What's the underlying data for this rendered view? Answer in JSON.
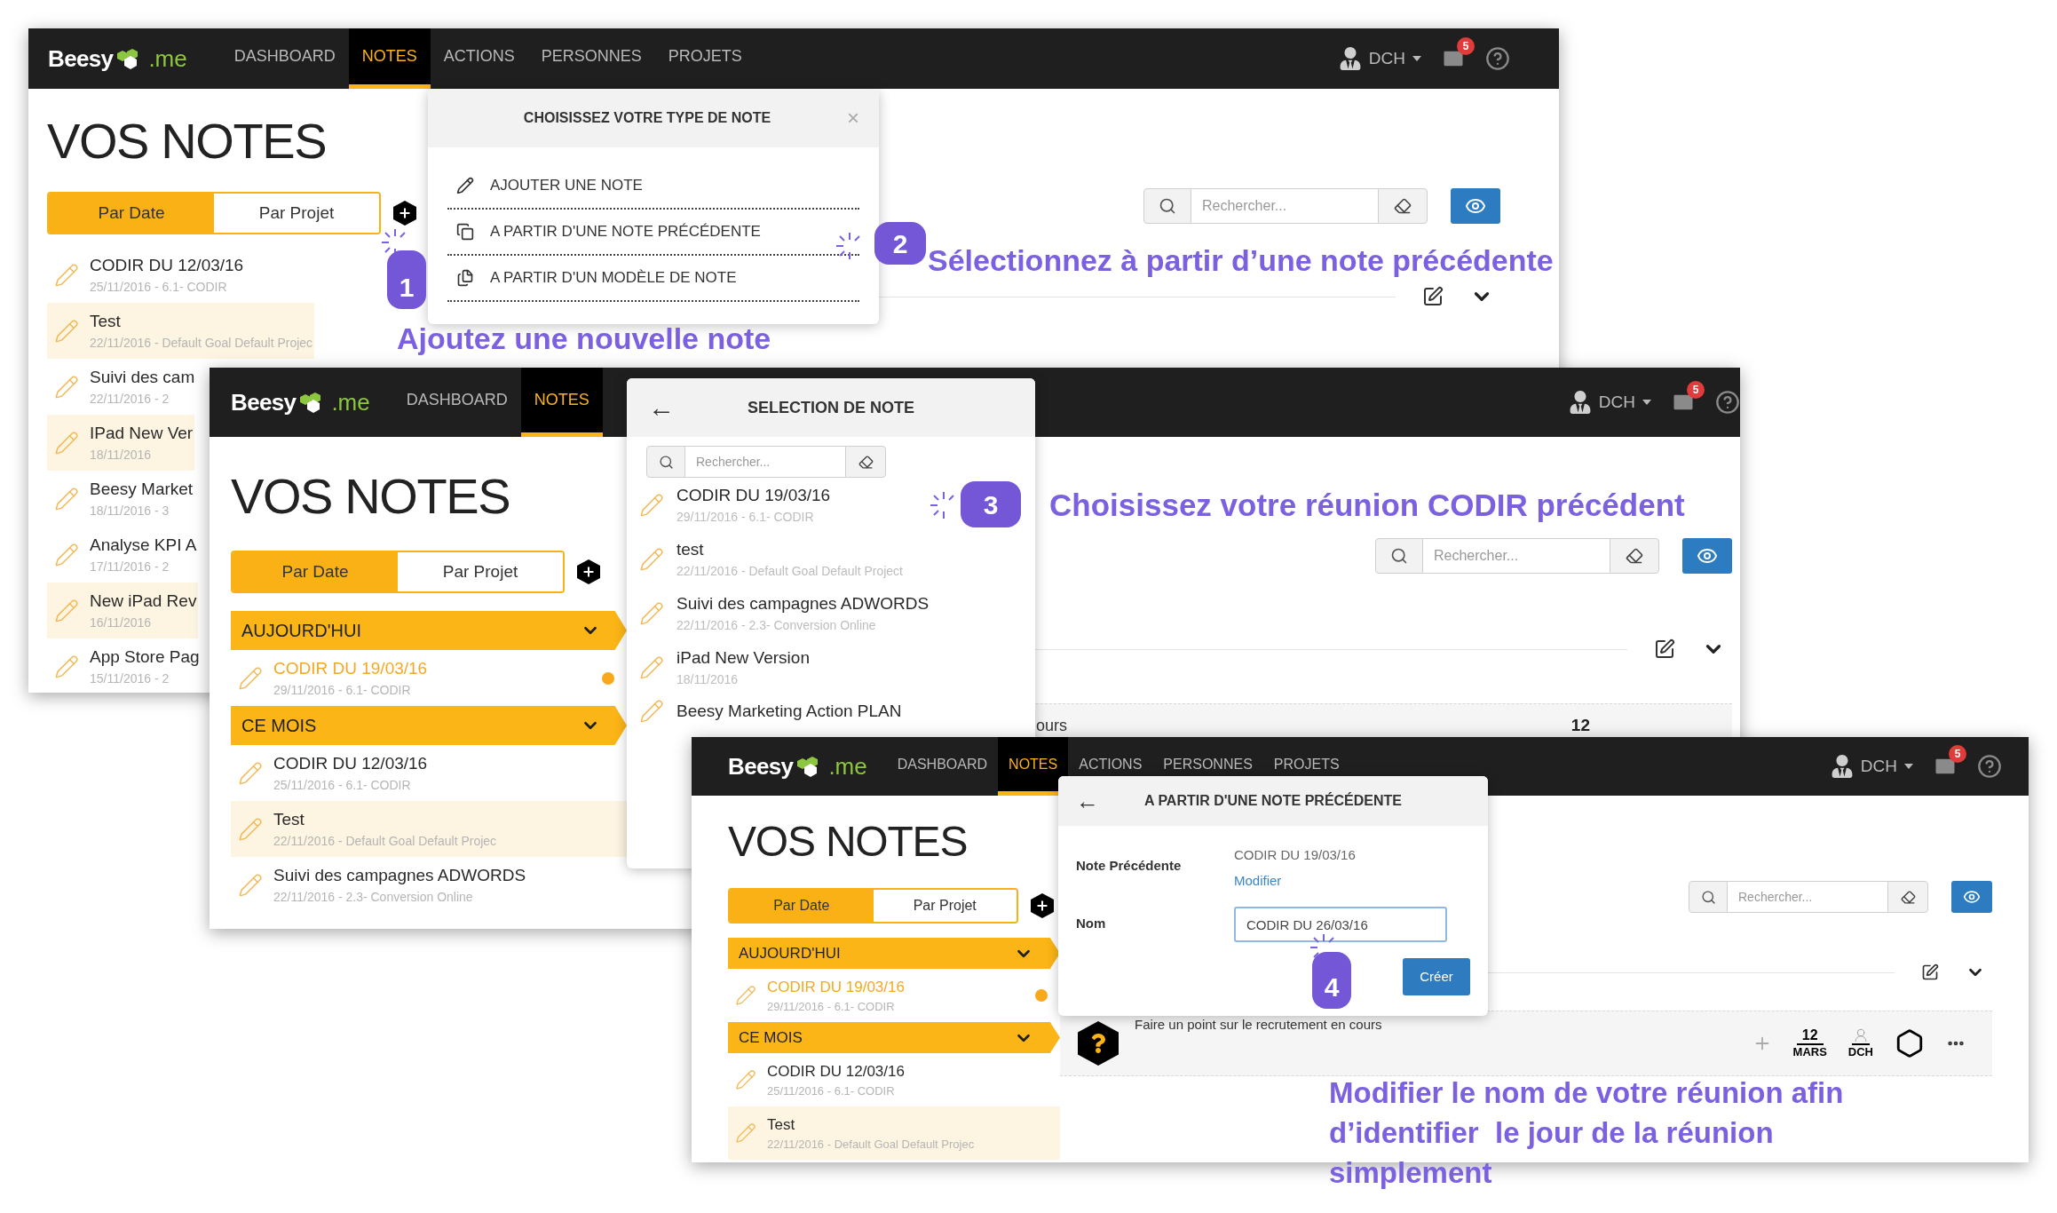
{
  "windows": [
    {
      "logo": {
        "name": "Beesy",
        "suffix": ".me"
      },
      "nav": [
        {
          "label": "DASHBOARD",
          "selected": false
        },
        {
          "label": "NOTES",
          "selected": true
        },
        {
          "label": "ACTIONS",
          "selected": false
        },
        {
          "label": "PERSONNES",
          "selected": false
        },
        {
          "label": "PROJETS",
          "selected": false
        }
      ],
      "user": "DCH",
      "mail_count": "5",
      "page_title": "VOS NOTES",
      "view_toggle": [
        {
          "label": "Par Date",
          "selected": true
        },
        {
          "label": "Par Projet",
          "selected": false
        }
      ],
      "sections": [
        {
          "notes": [
            {
              "title": "CODIR DU 12/03/16",
              "meta": "25/11/2016 - 6.1- CODIR",
              "selected": false,
              "highlighted": false
            },
            {
              "title": "Test",
              "meta": "22/11/2016 - Default Goal Default Projec",
              "selected": false,
              "highlighted": true
            },
            {
              "title": "Suivi des cam",
              "meta": "22/11/2016 - 2",
              "selected": false,
              "highlighted": false
            },
            {
              "title": "IPad New Ver",
              "meta": "18/11/2016",
              "selected": false,
              "highlighted": true
            },
            {
              "title": "Beesy Market",
              "meta": "18/11/2016 - 3",
              "selected": false,
              "highlighted": false
            },
            {
              "title": "Analyse KPI A",
              "meta": "17/11/2016 - 2",
              "selected": false,
              "highlighted": false
            },
            {
              "title": "New iPad Rev",
              "meta": "16/11/2016",
              "selected": false,
              "highlighted": true
            },
            {
              "title": "App Store Pag",
              "meta": "15/11/2016 - 2",
              "selected": false,
              "highlighted": false
            }
          ]
        }
      ],
      "search": {
        "placeholder": "Rechercher..."
      },
      "popup": {
        "kind": "type_menu",
        "title": "CHOISISSEZ VOTRE TYPE DE NOTE",
        "close": "×",
        "items": [
          {
            "label": "AJOUTER UNE NOTE"
          },
          {
            "label": "A PARTIR D'UNE NOTE PRÉCÉDENTE"
          },
          {
            "label": "A PARTIR D'UN MODÈLE DE NOTE"
          }
        ]
      }
    },
    {
      "logo": {
        "name": "Beesy",
        "suffix": ".me"
      },
      "nav": [
        {
          "label": "DASHBOARD",
          "selected": false
        },
        {
          "label": "NOTES",
          "selected": true
        }
      ],
      "user": "DCH",
      "mail_count": "5",
      "page_title": "VOS NOTES",
      "view_toggle": [
        {
          "label": "Par Date",
          "selected": true
        },
        {
          "label": "Par Projet",
          "selected": false
        }
      ],
      "sections": [
        {
          "label": "AUJOURD'HUI",
          "notes": [
            {
              "title": "CODIR DU 19/03/16",
              "meta": "29/11/2016 - 6.1- CODIR",
              "selected": true,
              "highlighted": false
            }
          ]
        },
        {
          "label": "CE MOIS",
          "notes": [
            {
              "title": "CODIR DU 12/03/16",
              "meta": "25/11/2016 - 6.1- CODIR",
              "selected": false,
              "highlighted": false
            },
            {
              "title": "Test",
              "meta": "22/11/2016 - Default Goal Default Projec",
              "selected": false,
              "highlighted": true
            },
            {
              "title": "Suivi des campagnes ADWORDS",
              "meta": "22/11/2016 - 2.3- Conversion Online",
              "selected": false,
              "highlighted": false
            }
          ]
        }
      ],
      "search": {
        "placeholder": "Rechercher..."
      },
      "task": {
        "kind": "fragment",
        "text": "ours",
        "date_day": "12"
      },
      "popup": {
        "kind": "note_selection",
        "back": "←",
        "title": "SELECTION DE NOTE",
        "search": {
          "placeholder": "Rechercher..."
        },
        "notes": [
          {
            "title": "CODIR DU 19/03/16",
            "meta": "29/11/2016 - 6.1- CODIR"
          },
          {
            "title": "test",
            "meta": "22/11/2016 - Default Goal Default Project"
          },
          {
            "title": "Suivi des campagnes ADWORDS",
            "meta": "22/11/2016 - 2.3- Conversion Online"
          },
          {
            "title": "iPad New Version",
            "meta": "18/11/2016"
          },
          {
            "title": "Beesy Marketing Action PLAN"
          }
        ]
      }
    },
    {
      "logo": {
        "name": "Beesy",
        "suffix": ".me"
      },
      "nav": [
        {
          "label": "DASHBOARD",
          "selected": false
        },
        {
          "label": "NOTES",
          "selected": true
        },
        {
          "label": "ACTIONS",
          "selected": false
        },
        {
          "label": "PERSONNES",
          "selected": false
        },
        {
          "label": "PROJETS",
          "selected": false
        }
      ],
      "user": "DCH",
      "mail_count": "5",
      "page_title": "VOS NOTES",
      "view_toggle": [
        {
          "label": "Par Date",
          "selected": true
        },
        {
          "label": "Par Projet",
          "selected": false
        }
      ],
      "sections": [
        {
          "label": "AUJOURD'HUI",
          "notes": [
            {
              "title": "CODIR DU 19/03/16",
              "meta": "29/11/2016 - 6.1- CODIR",
              "selected": true,
              "highlighted": false
            }
          ]
        },
        {
          "label": "CE MOIS",
          "notes": [
            {
              "title": "CODIR DU 12/03/16",
              "meta": "25/11/2016 - 6.1- CODIR",
              "selected": false,
              "highlighted": false
            },
            {
              "title": "Test",
              "meta": "22/11/2016 - Default Goal Default Projec",
              "selected": false,
              "highlighted": true
            }
          ]
        }
      ],
      "search": {
        "placeholder": "Rechercher..."
      },
      "task": {
        "kind": "full",
        "text": "Faire un point sur le recrutement en cours",
        "date_day": "12",
        "date_month": "MARS",
        "owner": "DCH"
      },
      "popup": {
        "kind": "from_previous",
        "back": "←",
        "title": "A PARTIR D'UNE NOTE PRÉCÉDENTE",
        "fields": [
          {
            "kind": "text",
            "label": "Note Précédente",
            "value": "CODIR DU 19/03/16",
            "link": "Modifier"
          },
          {
            "kind": "input",
            "label": "Nom",
            "value": "CODIR DU 26/03/16"
          }
        ],
        "submit": "Créer"
      }
    }
  ],
  "steps": [
    {
      "number": "1",
      "caption": "Ajoutez une nouvelle note"
    },
    {
      "number": "2",
      "caption": "Sélectionnez à partir d’une note précédente"
    },
    {
      "number": "3",
      "caption": "Choisissez votre réunion CODIR précédent"
    },
    {
      "number": "4",
      "caption": "Modifier le nom de votre réunion afin d’identifier  le jour de la réunion simplement"
    }
  ]
}
